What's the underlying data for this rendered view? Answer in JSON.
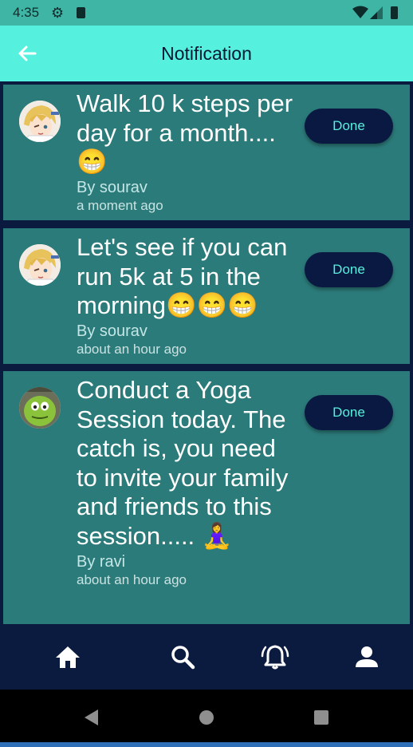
{
  "status_bar": {
    "time": "4:35",
    "icons": [
      "gear-icon",
      "sd-card-icon",
      "wifi-icon",
      "signal-icon",
      "battery-icon"
    ]
  },
  "app_bar": {
    "title": "Notification",
    "back_icon": "arrow-left-icon"
  },
  "notifications": [
    {
      "title": "Walk 10 k steps per day for a month.... 😁",
      "author": "By sourav",
      "time": "a moment ago",
      "button_label": "Done",
      "avatar": "anime-avatar"
    },
    {
      "title": "Let's see if you can run 5k at 5 in the morning😁😁😁",
      "author": "By sourav",
      "time": "about an hour ago",
      "button_label": "Done",
      "avatar": "anime-avatar"
    },
    {
      "title": "Conduct a Yoga Session today. The catch is, you need to invite your family and friends to this session..... 🧘‍♀️",
      "author": "By ravi",
      "time": "about an hour ago",
      "button_label": "Done",
      "avatar": "green-monster-avatar"
    }
  ],
  "bottom_nav": {
    "items": [
      "home-icon",
      "search-icon",
      "bell-ringing-icon",
      "person-icon"
    ]
  },
  "system_nav": {
    "items": [
      "back-triangle-icon",
      "home-circle-icon",
      "recents-square-icon"
    ]
  },
  "colors": {
    "status_bar": "#3fb5a5",
    "app_bar": "#56f0de",
    "background": "#0b1a3f",
    "card": "#2c7b7b",
    "button": "#0a1941",
    "button_text": "#56f0de"
  }
}
